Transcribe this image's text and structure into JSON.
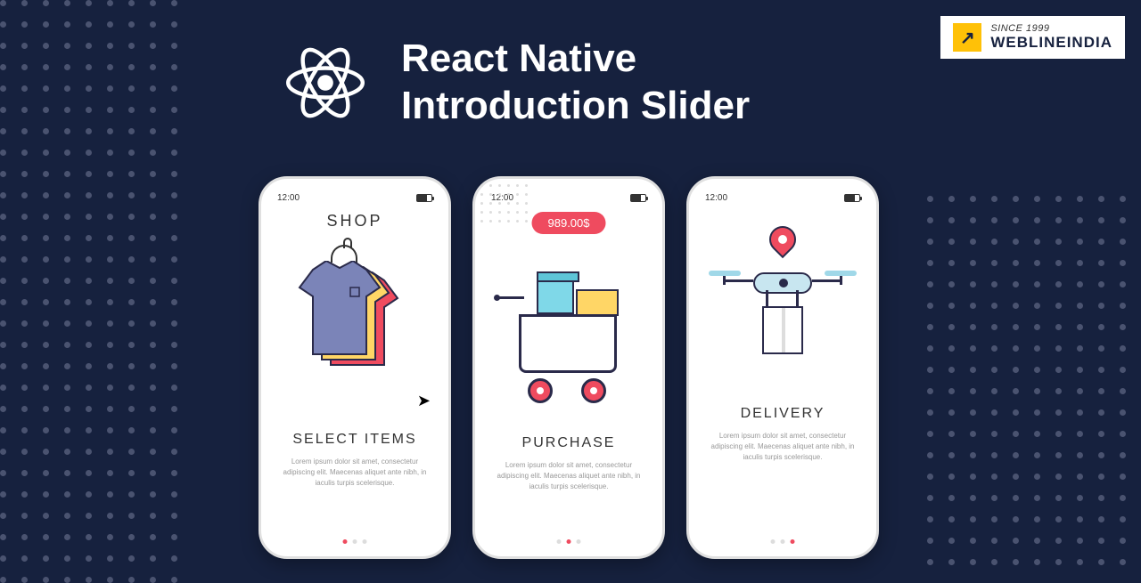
{
  "badge": {
    "since": "SINCE 1999",
    "name": "WEBLINEINDIA"
  },
  "title_line1": "React Native",
  "title_line2": "Introduction Slider",
  "phones": [
    {
      "time": "12:00",
      "header": "SHOP",
      "title": "SELECT ITEMS",
      "desc": "Lorem ipsum dolor sit amet, consectetur adipiscing elit. Maecenas aliquet ante nibh, in iaculis turpis scelerisque.",
      "active": 0
    },
    {
      "time": "12:00",
      "price": "989.00$",
      "title": "PURCHASE",
      "desc": "Lorem ipsum dolor sit amet, consectetur adipiscing elit. Maecenas aliquet ante nibh, in iaculis turpis scelerisque.",
      "active": 1
    },
    {
      "time": "12:00",
      "title": "DELIVERY",
      "desc": "Lorem ipsum dolor sit amet, consectetur adipiscing elit. Maecenas aliquet ante nibh, in iaculis turpis scelerisque.",
      "active": 2
    }
  ]
}
